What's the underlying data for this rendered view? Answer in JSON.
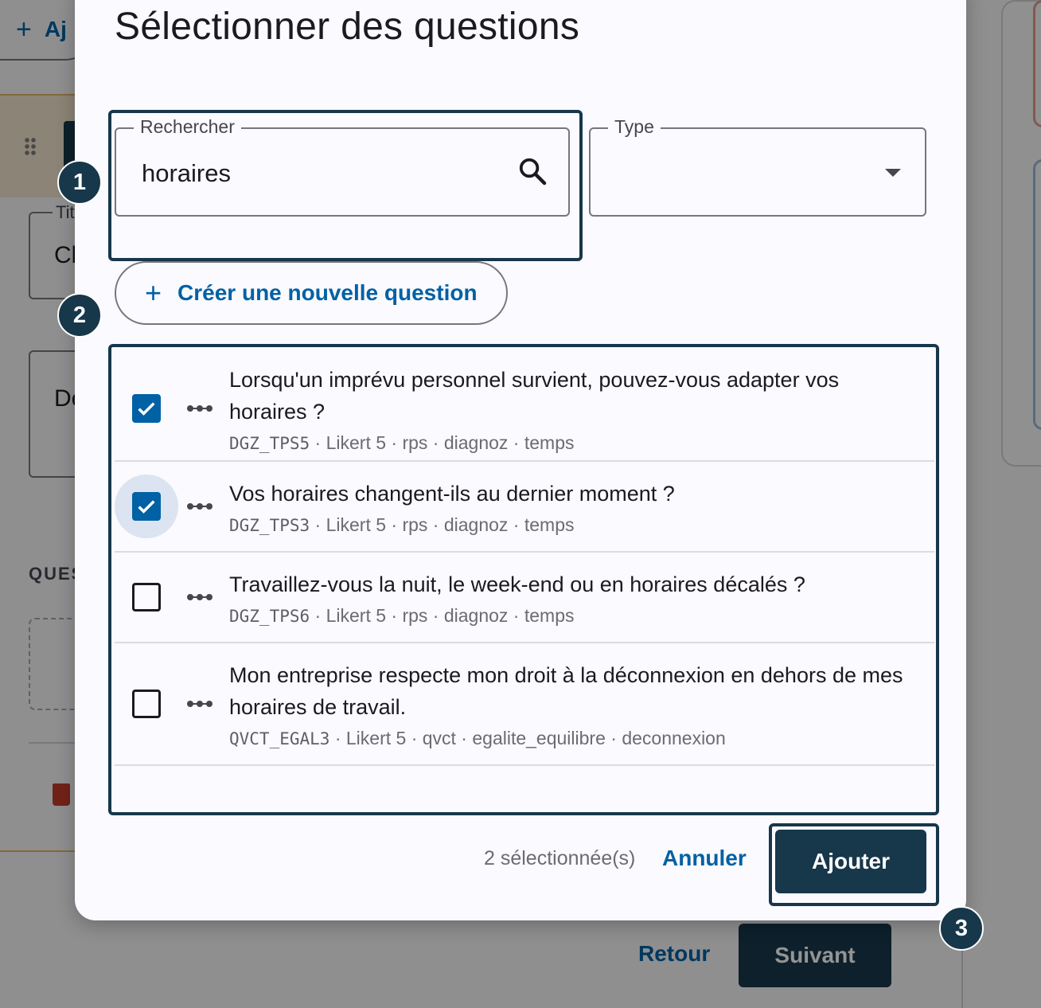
{
  "background": {
    "add_label": "Aj",
    "field_label": "Tit",
    "field_1_value": "Cl",
    "field_2_value": "De",
    "section_label": "QUES",
    "retour_label": "Retour",
    "suivant_label": "Suivant"
  },
  "dialog": {
    "title": "Sélectionner des questions",
    "search": {
      "label": "Rechercher",
      "value": "horaires"
    },
    "type": {
      "label": "Type",
      "value": ""
    },
    "create_label": "Créer une nouvelle question",
    "questions": [
      {
        "title": "Lorsqu'un imprévu personnel survient, pouvez-vous adapter vos horaires ?",
        "code": "DGZ_TPS5",
        "meta": " · Likert 5 · rps · diagnoz · temps",
        "checked": true
      },
      {
        "title": "Vos horaires changent-ils au dernier moment ?",
        "code": "DGZ_TPS3",
        "meta": " · Likert 5 · rps · diagnoz · temps",
        "checked": true
      },
      {
        "title": "Travaillez-vous la nuit, le week-end ou en horaires décalés ?",
        "code": "DGZ_TPS6",
        "meta": " · Likert 5 · rps · diagnoz · temps",
        "checked": false
      },
      {
        "title": "Mon entreprise respecte mon droit à la déconnexion en dehors de mes horaires de travail.",
        "code": "QVCT_EGAL3",
        "meta": " · Likert 5 · qvct · egalite_equilibre · deconnexion",
        "checked": false
      }
    ],
    "selected_count": "2 sélectionnée(s)",
    "cancel_label": "Annuler",
    "add_label": "Ajouter"
  },
  "badges": {
    "one": "1",
    "two": "2",
    "three": "3"
  },
  "colors": {
    "accent": "#0061a4",
    "primary_dark": "#17374a",
    "surface": "#fafaff"
  },
  "icons": {
    "search": "search-icon",
    "dropdown": "chevron-down-icon",
    "drag": "drag-handle-icon",
    "check": "check-icon",
    "plus": "plus-icon"
  }
}
